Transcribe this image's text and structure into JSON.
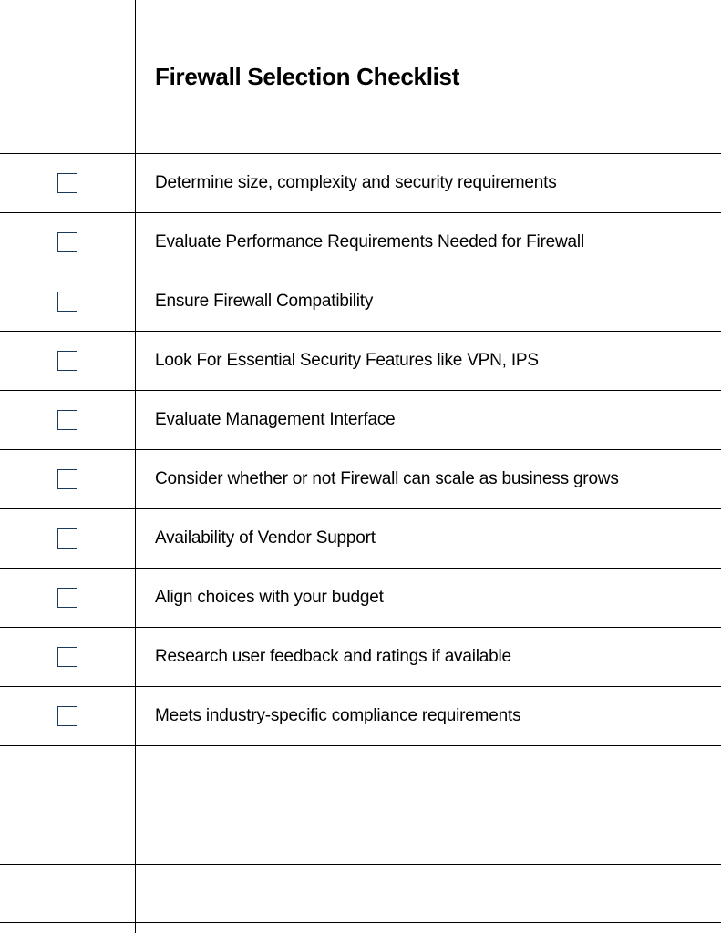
{
  "title": "Firewall Selection Checklist",
  "items": [
    {
      "label": "Determine size, complexity and security requirements"
    },
    {
      "label": "Evaluate Performance Requirements Needed for Firewall"
    },
    {
      "label": "Ensure Firewall Compatibility"
    },
    {
      "label": "Look For Essential Security Features like VPN, IPS"
    },
    {
      "label": "Evaluate Management Interface"
    },
    {
      "label": "Consider whether or not Firewall can scale as business grows"
    },
    {
      "label": "Availability of Vendor Support"
    },
    {
      "label": "Align choices with your budget"
    },
    {
      "label": "Research user feedback and ratings if available"
    },
    {
      "label": "Meets industry-specific compliance requirements"
    }
  ],
  "emptyRows": 3
}
